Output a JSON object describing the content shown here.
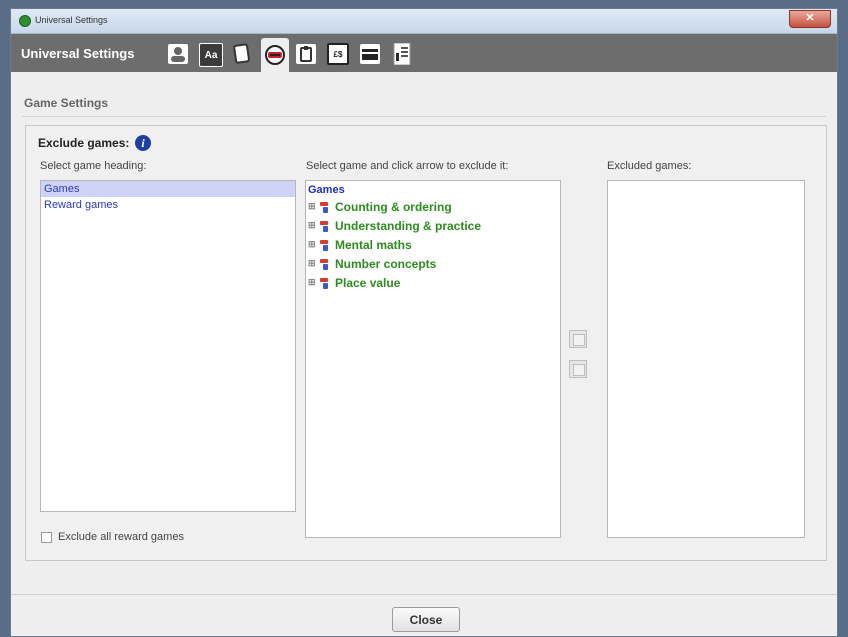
{
  "window": {
    "title": "Universal Settings",
    "close_label": "✕"
  },
  "toolbar": {
    "title": "Universal Settings",
    "buttons": [
      {
        "icon": "user-icon"
      },
      {
        "icon": "font-icon",
        "glyph": "Aa"
      },
      {
        "icon": "card-icon"
      },
      {
        "icon": "game-controller-icon"
      },
      {
        "icon": "clipboard-icon"
      },
      {
        "icon": "currency-icon",
        "glyph": "£$"
      },
      {
        "icon": "window-icon"
      },
      {
        "icon": "document-list-icon"
      }
    ],
    "active_index": 3
  },
  "page": {
    "section_title": "Game Settings",
    "group_title": "Exclude games:",
    "info_glyph": "i"
  },
  "columns": {
    "headings_label": "Select game heading:",
    "games_label": "Select game and click arrow to exclude it:",
    "excluded_label": "Excluded games:"
  },
  "headings": [
    {
      "label": "Games",
      "selected": true
    },
    {
      "label": "Reward games",
      "selected": false
    }
  ],
  "tree": {
    "root": "Games",
    "items": [
      "Counting & ordering",
      "Understanding & practice",
      "Mental maths",
      "Number concepts",
      "Place value"
    ]
  },
  "excluded_games": [],
  "exclude_reward": {
    "label": "Exclude all reward games",
    "checked": false
  },
  "footer": {
    "close_label": "Close"
  },
  "colors": {
    "toolbar": "#6d6d6d",
    "link_blue": "#2a3bbd",
    "tree_green": "#2f8a22",
    "selected_bg": "#cfd3f5"
  }
}
